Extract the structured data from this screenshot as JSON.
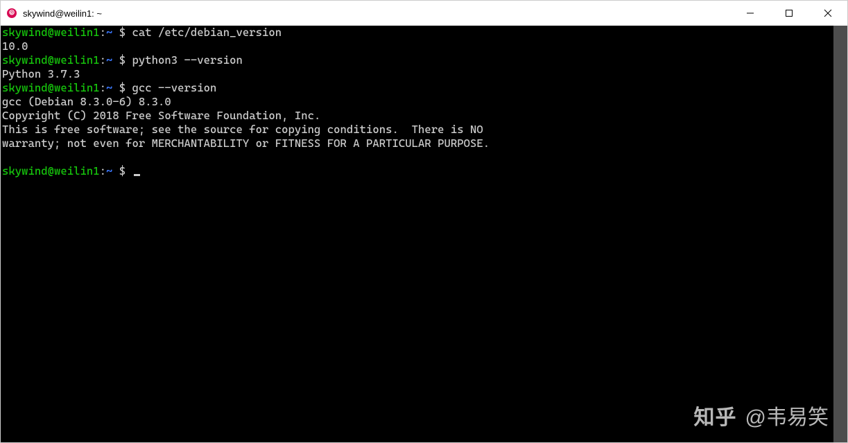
{
  "window": {
    "title": "skywind@weilin1: ~"
  },
  "prompt": {
    "user": "skywind",
    "at": "@",
    "host": "weilin1",
    "sep": ":",
    "path": "~",
    "symbol": "$"
  },
  "lines": [
    {
      "type": "cmd",
      "text": "cat /etc/debian_version"
    },
    {
      "type": "out",
      "text": "10.0"
    },
    {
      "type": "cmd",
      "text": "python3 --version"
    },
    {
      "type": "out",
      "text": "Python 3.7.3"
    },
    {
      "type": "cmd",
      "text": "gcc --version"
    },
    {
      "type": "out",
      "text": "gcc (Debian 8.3.0-6) 8.3.0"
    },
    {
      "type": "out",
      "text": "Copyright (C) 2018 Free Software Foundation, Inc."
    },
    {
      "type": "out",
      "text": "This is free software; see the source for copying conditions.  There is NO"
    },
    {
      "type": "out",
      "text": "warranty; not even for MERCHANTABILITY or FITNESS FOR A PARTICULAR PURPOSE."
    },
    {
      "type": "out",
      "text": ""
    },
    {
      "type": "cmd-empty",
      "text": ""
    }
  ],
  "watermark": {
    "logo": "知乎",
    "author": "@韦易笑"
  }
}
